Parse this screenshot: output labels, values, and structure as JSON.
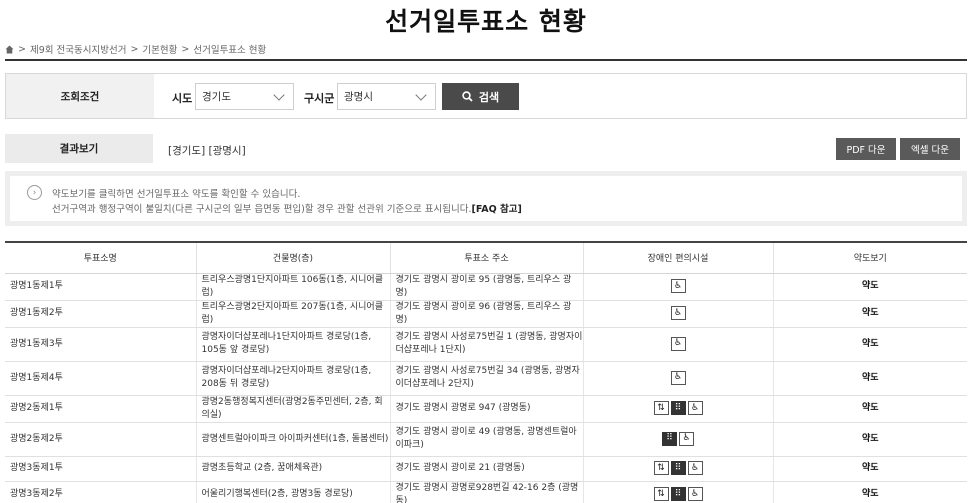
{
  "page": {
    "title": "선거일투표소 현황"
  },
  "breadcrumb": {
    "items": [
      "제9회 전국동시지방선거",
      "기본현황",
      "선거일투표소 현황"
    ],
    "separator": ">"
  },
  "search": {
    "label": "조회조건",
    "sido_label": "시도",
    "sido_value": "경기도",
    "gusigun_label": "구시군",
    "gusigun_value": "광명시",
    "button_label": "검색"
  },
  "result": {
    "label": "결과보기",
    "text": "[경기도] [광명시]",
    "pdf_label": "PDF 다운",
    "excel_label": "엑셀 다운"
  },
  "notice": {
    "line1": "약도보기를 클릭하면 선거일투표소 약도를 확인할 수 있습니다.",
    "line2": "선거구역과 행정구역이 불일치(다른 구시군의 일부 읍면동 편입)할 경우 관할 선관위 기준으로 표시됩니다.",
    "faq": "[FAQ 참고]"
  },
  "table": {
    "headers": [
      "투표소명",
      "건물명(층)",
      "투표소 주소",
      "장애인 편의시설",
      "약도보기"
    ],
    "rows": [
      {
        "name": "광명1동제1투",
        "building": "트리우스광명1단지아파트 106동(1층, 시니어클럽)",
        "address": "경기도 광명시 광이로 95 (광명동, 트리우스 광명)",
        "facilities": [
          "wheelchair-icon"
        ],
        "map": "약도"
      },
      {
        "name": "광명1동제2투",
        "building": "트리우스광명2단지아파트 207동(1층, 시니어클럽)",
        "address": "경기도 광명시 광이로 96 (광명동, 트리우스 광명)",
        "facilities": [
          "wheelchair-icon"
        ],
        "map": "약도"
      },
      {
        "name": "광명1동제3투",
        "building": "광명자이더샵포레나1단지아파트 경로당(1층, 105동 앞 경로당)",
        "address": "경기도 광명시 사성로75번길 1 (광명동, 광명자이더샵포레나 1단지)",
        "facilities": [
          "wheelchair-icon"
        ],
        "map": "약도"
      },
      {
        "name": "광명1동제4투",
        "building": "광명자이더샵포레나2단지아파트 경로당(1층, 208동 뒤 경로당)",
        "address": "경기도 광명시 사성로75번길 34 (광명동, 광명자이더샵포레나 2단지)",
        "facilities": [
          "wheelchair-icon"
        ],
        "map": "약도"
      },
      {
        "name": "광명2동제1투",
        "building": "광명2동행정복지센터(광명2동주민센터, 2층, 회의실)",
        "address": "경기도 광명시 광명로 947 (광명동)",
        "facilities": [
          "elevator-icon",
          "braille-icon",
          "wheelchair-icon"
        ],
        "map": "약도"
      },
      {
        "name": "광명2동제2투",
        "building": "광명센트럴아이파크 아이파커센터(1층, 돌봄센터)",
        "address": "경기도 광명시 광이로 49 (광명동, 광명센트럴아이파크)",
        "facilities": [
          "braille-icon",
          "wheelchair-icon"
        ],
        "map": "약도"
      },
      {
        "name": "광명3동제1투",
        "building": "광명초등학교 (2층, 꿈애체육관)",
        "address": "경기도 광명시 광이로 21 (광명동)",
        "facilities": [
          "elevator-icon",
          "braille-icon",
          "wheelchair-icon"
        ],
        "map": "약도"
      },
      {
        "name": "광명3동제2투",
        "building": "어울리기행복센터(2층, 광명3동 경로당)",
        "address": "경기도 광명시 광명로928번길 42-16 2층 (광명동)",
        "facilities": [
          "elevator-icon",
          "braille-icon",
          "wheelchair-icon"
        ],
        "map": "약도"
      }
    ]
  }
}
